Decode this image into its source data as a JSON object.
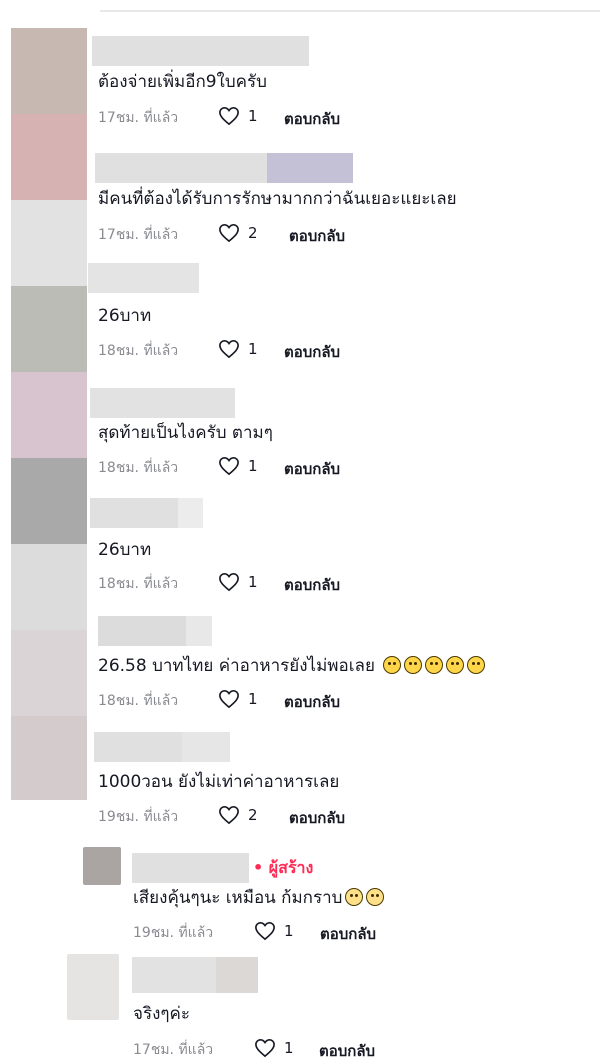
{
  "colors": {
    "creator_accent": "#fe2c55",
    "meta_gray": "#8a8b91"
  },
  "comments": [
    {
      "text": "ต้องจ่ายเพิ่มอีก9ใบครับ",
      "time": "17ชม. ที่แล้ว",
      "likes": "1",
      "reply": "ตอบกลับ"
    },
    {
      "text": "มีคนที่ต้องได้รับการรักษามากกว่าฉันเยอะแยะเลย",
      "time": "17ชม. ที่แล้ว",
      "likes": "2",
      "reply": "ตอบกลับ"
    },
    {
      "text": "26บาท",
      "time": "18ชม. ที่แล้ว",
      "likes": "1",
      "reply": "ตอบกลับ"
    },
    {
      "text": "สุดท้ายเป็นไงครับ ตามๆ",
      "time": "18ชม. ที่แล้ว",
      "likes": "1",
      "reply": "ตอบกลับ"
    },
    {
      "text": "26บาท",
      "time": "18ชม. ที่แล้ว",
      "likes": "1",
      "reply": "ตอบกลับ"
    },
    {
      "text": "26.58 บาทไทย ค่าอาหารยังไม่พอเลย",
      "emojis": [
        "sad-face-icon",
        "sad-face-icon",
        "sad-face-icon",
        "crying-face-icon",
        "crying-face-icon"
      ],
      "time": "18ชม. ที่แล้ว",
      "likes": "1",
      "reply": "ตอบกลับ"
    },
    {
      "text": "1000วอน ยังไม่เท่าค่าอาหารเลย",
      "time": "19ชม. ที่แล้ว",
      "likes": "2",
      "reply": "ตอบกลับ"
    }
  ],
  "replies": [
    {
      "creator_label": "• ผู้สร้าง",
      "text": "เสียงคุ้นๆนะ เหมือน ก้มกราบ",
      "emojis": [
        "flushed-face-icon",
        "flushed-face-icon"
      ],
      "time": "19ชม. ที่แล้ว",
      "likes": "1",
      "reply": "ตอบกลับ"
    },
    {
      "text": "จริงๆค่ะ",
      "time": "17ชม. ที่แล้ว",
      "likes": "1",
      "reply": "ตอบกลับ"
    }
  ]
}
